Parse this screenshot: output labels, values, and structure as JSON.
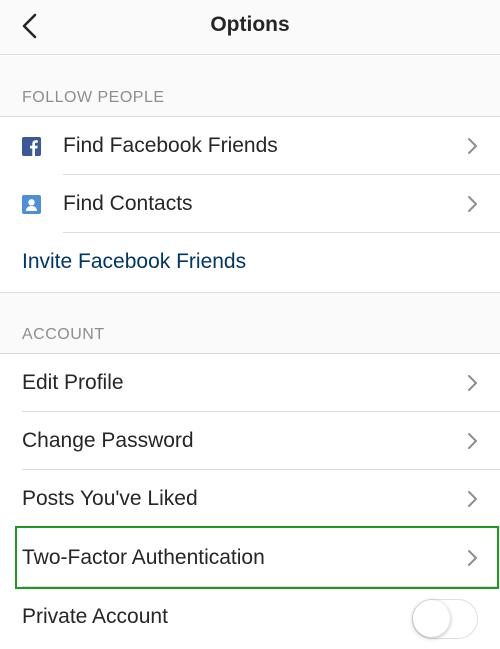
{
  "nav": {
    "title": "Options"
  },
  "sections": {
    "follow_people": {
      "header": "FOLLOW PEOPLE"
    },
    "account": {
      "header": "ACCOUNT"
    }
  },
  "follow_people": {
    "find_facebook_friends": "Find Facebook Friends",
    "find_contacts": "Find Contacts",
    "invite_facebook_friends": "Invite Facebook Friends"
  },
  "account": {
    "edit_profile": "Edit Profile",
    "change_password": "Change Password",
    "posts_liked": "Posts You've Liked",
    "two_factor": "Two-Factor Authentication",
    "private_account": "Private Account",
    "private_account_enabled": false
  },
  "colors": {
    "link": "#003569",
    "highlight": "#1c9b1c",
    "facebook": "#3b5998"
  },
  "icons": {
    "back": "chevron-left-icon",
    "facebook": "facebook-icon",
    "contacts": "contacts-icon",
    "row_arrow": "chevron-right-icon"
  }
}
